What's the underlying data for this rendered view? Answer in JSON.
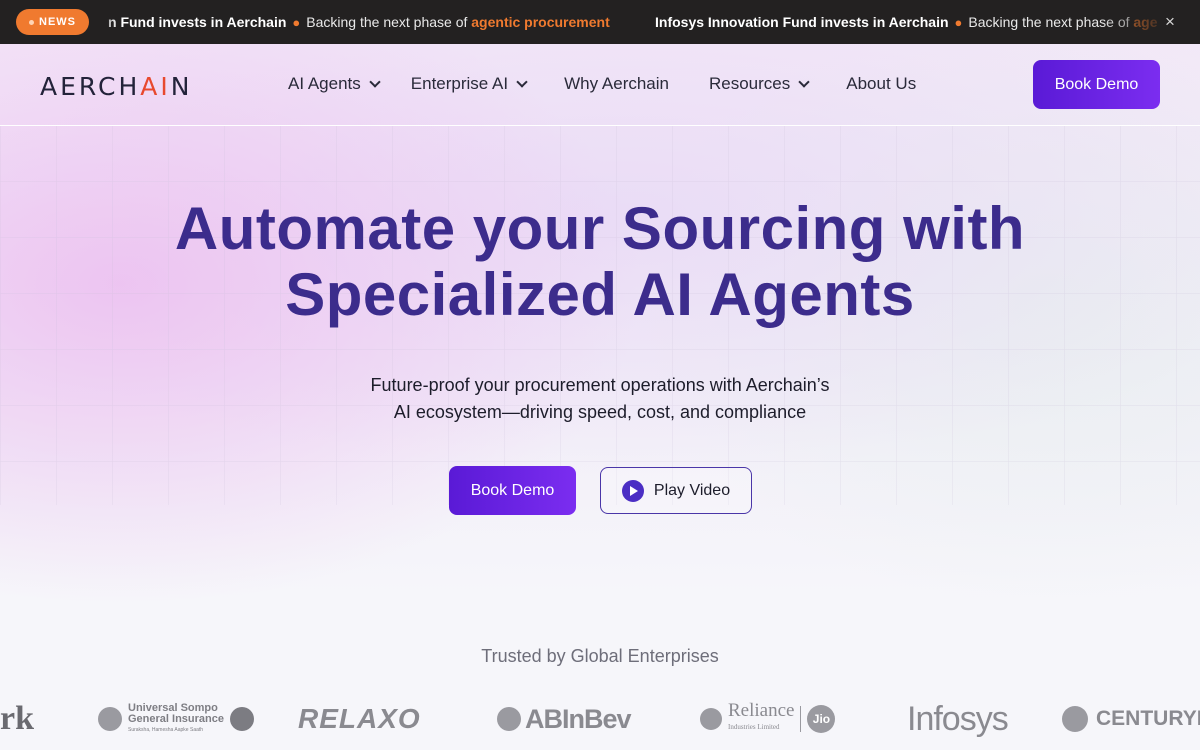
{
  "news": {
    "badge": "NEWS",
    "item1": {
      "lead": "n Fund invests in Aerchain",
      "middle": "Backing the next phase of",
      "accent": "agentic procurement"
    },
    "item2": {
      "lead": "Infosys Innovation Fund invests in Aerchain",
      "middle": "Backing the next phase of",
      "accent": "age"
    },
    "close": "×"
  },
  "header": {
    "logo": {
      "pre": "AERCH",
      "ai": "AI",
      "post": "N"
    },
    "nav": [
      {
        "label": "AI Agents",
        "dropdown": true
      },
      {
        "label": "Enterprise AI",
        "dropdown": true
      },
      {
        "label": "Why Aerchain",
        "dropdown": false
      },
      {
        "label": "Resources",
        "dropdown": true
      },
      {
        "label": "About Us",
        "dropdown": false
      }
    ],
    "cta": "Book Demo"
  },
  "hero": {
    "title_line1": "Automate your Sourcing with",
    "title_line2": "Specialized AI Agents",
    "subtitle_line1": "Future-proof your procurement operations with Aerchain’s",
    "subtitle_line2": "AI ecosystem—driving speed, cost, and compliance",
    "cta_primary": "Book Demo",
    "cta_video": "Play Video"
  },
  "trusted": {
    "heading": "Trusted by Global Enterprises",
    "logos": {
      "partial": "rk",
      "sompo_line1": "Universal Sompo",
      "sompo_line2": "General Insurance",
      "sompo_tagline": "Suraksha, Hamesha Aapke Saath",
      "relaxo": "RELAXO",
      "abinbev": "ABInBev",
      "reliance": "Reliance",
      "reliance_sub": "Industries Limited",
      "jio": "Jio",
      "infosys": "Infosys",
      "century": "CENTURYPLY"
    }
  },
  "colors": {
    "brand_purple": "#5a1ad6",
    "title_purple": "#3c2c8c",
    "news_orange": "#f07a2f",
    "logo_red": "#e8492e"
  }
}
